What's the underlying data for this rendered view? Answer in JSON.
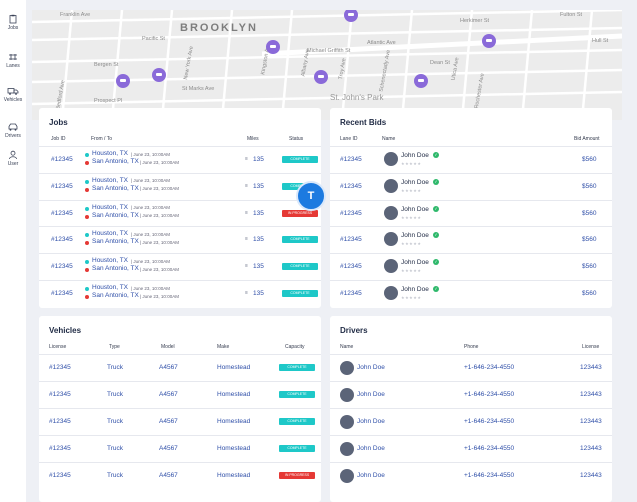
{
  "sidebar": {
    "items": [
      {
        "label": "Jobs"
      },
      {
        "label": "Lanes"
      },
      {
        "label": "Vehicles"
      },
      {
        "label": "Drivers"
      },
      {
        "label": "User"
      }
    ]
  },
  "map": {
    "labels": [
      {
        "text": "BROOKLYN",
        "kind": "big"
      },
      {
        "text": "Atlantic Ave"
      },
      {
        "text": "Michael Griffith St"
      },
      {
        "text": "Dean St"
      },
      {
        "text": "Bergen St"
      },
      {
        "text": "Pacific St"
      },
      {
        "text": "Herkimer St"
      },
      {
        "text": "Fulton St"
      },
      {
        "text": "Prospect Pl"
      },
      {
        "text": "St Marks Ave"
      },
      {
        "text": "St. John's Park",
        "kind": "park"
      },
      {
        "text": "New York Ave"
      },
      {
        "text": "Kingston Ave"
      },
      {
        "text": "Albany Ave"
      },
      {
        "text": "Troy Ave"
      },
      {
        "text": "Schenectady Ave"
      },
      {
        "text": "Utica Ave"
      },
      {
        "text": "Rochester Ave"
      },
      {
        "text": "Bedford Ave"
      },
      {
        "text": "Franklin Ave"
      },
      {
        "text": "Hull St"
      }
    ]
  },
  "jobs": {
    "title": "Jobs",
    "headers": {
      "id": "Job ID",
      "route": "From / To",
      "miles": "Miles",
      "status": "Status"
    },
    "rows": [
      {
        "id": "#12345",
        "from": "Houston, TX",
        "to": "San Antonio, TX",
        "from_date": "| June 23, 10:00AM",
        "to_date": "| June 23, 10:00AM",
        "miles": "135",
        "status": "COMPLETE",
        "status_kind": "complete"
      },
      {
        "id": "#12345",
        "from": "Houston, TX",
        "to": "San Antonio, TX",
        "from_date": "| June 23, 10:00AM",
        "to_date": "| June 23, 10:00AM",
        "miles": "135",
        "status": "COMPLETE",
        "status_kind": "complete"
      },
      {
        "id": "#12345",
        "from": "Houston, TX",
        "to": "San Antonio, TX",
        "from_date": "| June 23, 10:00AM",
        "to_date": "| June 23, 10:00AM",
        "miles": "135",
        "status": "IN PROGRESS",
        "status_kind": "progress"
      },
      {
        "id": "#12345",
        "from": "Houston, TX",
        "to": "San Antonio, TX",
        "from_date": "| June 23, 10:00AM",
        "to_date": "| June 23, 10:00AM",
        "miles": "135",
        "status": "COMPLETE",
        "status_kind": "complete"
      },
      {
        "id": "#12345",
        "from": "Houston, TX",
        "to": "San Antonio, TX",
        "from_date": "| June 23, 10:00AM",
        "to_date": "| June 23, 10:00AM",
        "miles": "135",
        "status": "COMPLETE",
        "status_kind": "complete"
      },
      {
        "id": "#12345",
        "from": "Houston, TX",
        "to": "San Antonio, TX",
        "from_date": "| June 23, 10:00AM",
        "to_date": "| June 23, 10:00AM",
        "miles": "135",
        "status": "COMPLETE",
        "status_kind": "complete"
      }
    ]
  },
  "bids": {
    "title": "Recent Bids",
    "headers": {
      "lane": "Lane ID",
      "name": "Name",
      "amount": "Bid Amount"
    },
    "rows": [
      {
        "lane": "#12345",
        "name": "John Doe",
        "amount": "$560"
      },
      {
        "lane": "#12345",
        "name": "John Doe",
        "amount": "$560"
      },
      {
        "lane": "#12345",
        "name": "John Doe",
        "amount": "$560"
      },
      {
        "lane": "#12345",
        "name": "John Doe",
        "amount": "$560"
      },
      {
        "lane": "#12345",
        "name": "John Doe",
        "amount": "$560"
      },
      {
        "lane": "#12345",
        "name": "John Doe",
        "amount": "$560"
      }
    ]
  },
  "vehicles": {
    "title": "Vehicles",
    "headers": {
      "license": "License",
      "type": "Type",
      "model": "Model",
      "make": "Make",
      "capacity": "Capacity"
    },
    "rows": [
      {
        "license": "#12345",
        "type": "Truck",
        "model": "A4567",
        "make": "Homestead",
        "status": "COMPLETE",
        "status_kind": "complete"
      },
      {
        "license": "#12345",
        "type": "Truck",
        "model": "A4567",
        "make": "Homestead",
        "status": "COMPLETE",
        "status_kind": "complete"
      },
      {
        "license": "#12345",
        "type": "Truck",
        "model": "A4567",
        "make": "Homestead",
        "status": "COMPLETE",
        "status_kind": "complete"
      },
      {
        "license": "#12345",
        "type": "Truck",
        "model": "A4567",
        "make": "Homestead",
        "status": "COMPLETE",
        "status_kind": "complete"
      },
      {
        "license": "#12345",
        "type": "Truck",
        "model": "A4567",
        "make": "Homestead",
        "status": "IN PROGRESS",
        "status_kind": "progress"
      }
    ]
  },
  "drivers": {
    "title": "Drivers",
    "headers": {
      "name": "Name",
      "phone": "Phone",
      "license": "License"
    },
    "rows": [
      {
        "name": "John Doe",
        "phone": "+1-646-234-4550",
        "license": "123443"
      },
      {
        "name": "John Doe",
        "phone": "+1-646-234-4550",
        "license": "123443"
      },
      {
        "name": "John Doe",
        "phone": "+1-646-234-4550",
        "license": "123443"
      },
      {
        "name": "John Doe",
        "phone": "+1-646-234-4550",
        "license": "123443"
      },
      {
        "name": "John Doe",
        "phone": "+1-646-234-4550",
        "license": "123443"
      }
    ]
  },
  "fab": {
    "label": "T"
  },
  "colors": {
    "accent": "#1ec8c8",
    "danger": "#e53935",
    "link": "#2f4fa8",
    "pin": "#8a6ad9",
    "fab": "#1c7ae0"
  }
}
